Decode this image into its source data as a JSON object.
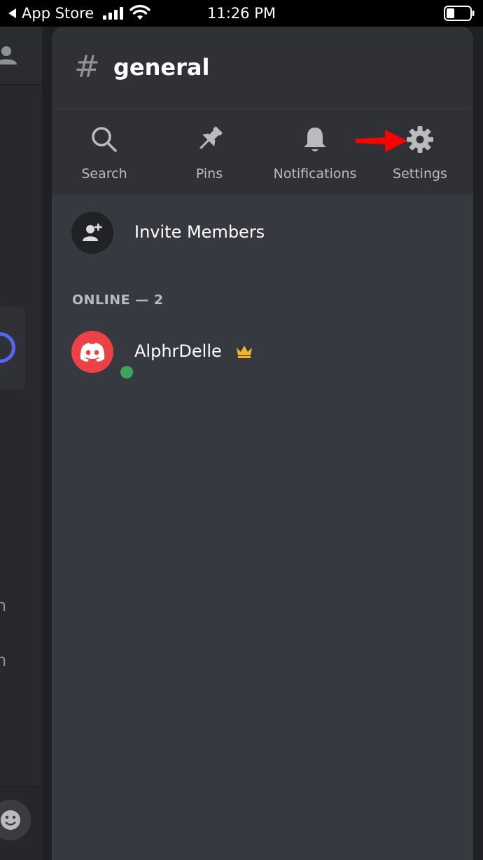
{
  "status_bar": {
    "back_app": "App Store",
    "time": "11:26 PM"
  },
  "channel": {
    "hash": "#",
    "name": "general"
  },
  "actions": [
    {
      "label": "Search",
      "icon": "search-icon"
    },
    {
      "label": "Pins",
      "icon": "pin-icon"
    },
    {
      "label": "Notifications",
      "icon": "bell-icon"
    },
    {
      "label": "Settings",
      "icon": "gear-icon"
    }
  ],
  "invite": {
    "label": "Invite Members",
    "icon": "add-user-icon"
  },
  "members": {
    "section_header": "ONLINE — 2",
    "list": [
      {
        "name": "AlphrDelle",
        "status": "online",
        "badge": "crown-icon"
      }
    ]
  },
  "background_view": {
    "partial_texts": [
      "n",
      "n"
    ]
  },
  "colors": {
    "drawer_bg": "#36393f",
    "header_bg": "#2f3136",
    "accent_red": "#ed4245",
    "online_green": "#3ba55d",
    "crown_gold": "#f0b232",
    "annotation_arrow": "#ff0000"
  }
}
